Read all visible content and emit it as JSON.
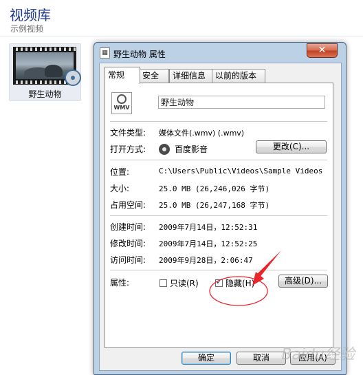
{
  "library": {
    "title": "视频库",
    "subtitle": "示例视频",
    "item_label": "野生动物"
  },
  "dialog": {
    "title": "野生动物 属性",
    "close_glyph": "✕",
    "tabs": [
      {
        "label": "常规"
      },
      {
        "label": "安全"
      },
      {
        "label": "详细信息"
      },
      {
        "label": "以前的版本"
      }
    ],
    "icon_text": "WMV",
    "file_name": "野生动物",
    "rows": {
      "file_type": {
        "label": "文件类型:",
        "value": "媒体文件(.wmv) (.wmv)"
      },
      "open_with": {
        "label": "打开方式:",
        "value": "百度影音",
        "button": "更改(C)..."
      },
      "location": {
        "label": "位置:",
        "value": "C:\\Users\\Public\\Videos\\Sample Videos"
      },
      "size": {
        "label": "大小:",
        "value": "25.0 MB (26,246,026 字节)"
      },
      "size_on_disk": {
        "label": "占用空间:",
        "value": "25.0 MB (26,247,168 字节)"
      },
      "created": {
        "label": "创建时间:",
        "value": "2009年7月14日，12:52:31"
      },
      "modified": {
        "label": "修改时间:",
        "value": "2009年7月14日，12:52:25"
      },
      "accessed": {
        "label": "访问时间:",
        "value": "2009年9月28日，2:06:47"
      }
    },
    "attributes": {
      "label": "属性:",
      "readonly": {
        "label": "只读(R)",
        "checked": false
      },
      "hidden": {
        "label": "隐藏(H)",
        "checked": true
      },
      "advanced_button": "高级(D)..."
    },
    "buttons": {
      "ok": "确定",
      "cancel": "取消",
      "apply": "应用(A)"
    }
  },
  "annotation": {
    "color": "#e8262b"
  },
  "watermark": "Baidu经验"
}
